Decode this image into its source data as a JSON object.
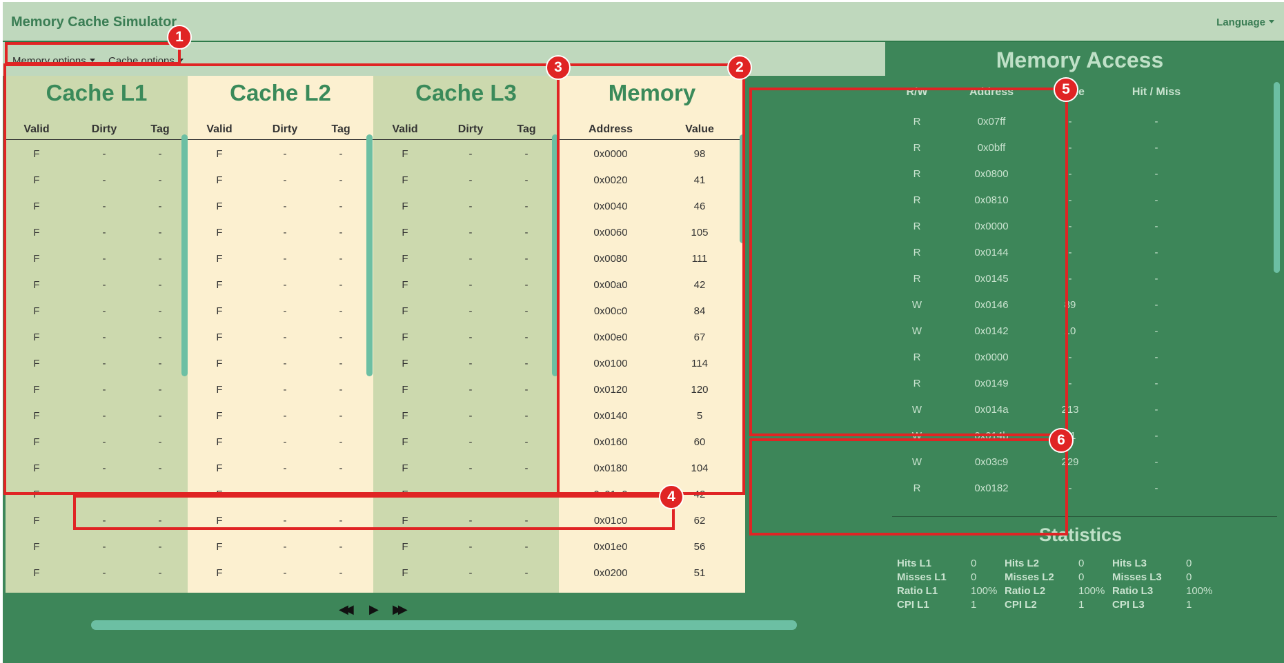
{
  "app": {
    "title": "Memory Cache Simulator",
    "language_label": "Language"
  },
  "options": {
    "memory": "Memory options",
    "cache": "Cache options"
  },
  "cache_headers": [
    "Valid",
    "Dirty",
    "Tag"
  ],
  "caches": [
    {
      "title": "Cache L1",
      "rows": [
        [
          "F",
          "-",
          "-"
        ],
        [
          "F",
          "-",
          "-"
        ],
        [
          "F",
          "-",
          "-"
        ],
        [
          "F",
          "-",
          "-"
        ],
        [
          "F",
          "-",
          "-"
        ],
        [
          "F",
          "-",
          "-"
        ],
        [
          "F",
          "-",
          "-"
        ],
        [
          "F",
          "-",
          "-"
        ],
        [
          "F",
          "-",
          "-"
        ],
        [
          "F",
          "-",
          "-"
        ],
        [
          "F",
          "-",
          "-"
        ],
        [
          "F",
          "-",
          "-"
        ],
        [
          "F",
          "-",
          "-"
        ],
        [
          "F",
          "-",
          "-"
        ],
        [
          "F",
          "-",
          "-"
        ],
        [
          "F",
          "-",
          "-"
        ],
        [
          "F",
          "-",
          "-"
        ]
      ]
    },
    {
      "title": "Cache L2",
      "rows": [
        [
          "F",
          "-",
          "-"
        ],
        [
          "F",
          "-",
          "-"
        ],
        [
          "F",
          "-",
          "-"
        ],
        [
          "F",
          "-",
          "-"
        ],
        [
          "F",
          "-",
          "-"
        ],
        [
          "F",
          "-",
          "-"
        ],
        [
          "F",
          "-",
          "-"
        ],
        [
          "F",
          "-",
          "-"
        ],
        [
          "F",
          "-",
          "-"
        ],
        [
          "F",
          "-",
          "-"
        ],
        [
          "F",
          "-",
          "-"
        ],
        [
          "F",
          "-",
          "-"
        ],
        [
          "F",
          "-",
          "-"
        ],
        [
          "F",
          "-",
          "-"
        ],
        [
          "F",
          "-",
          "-"
        ],
        [
          "F",
          "-",
          "-"
        ],
        [
          "F",
          "-",
          "-"
        ]
      ]
    },
    {
      "title": "Cache L3",
      "rows": [
        [
          "F",
          "-",
          "-"
        ],
        [
          "F",
          "-",
          "-"
        ],
        [
          "F",
          "-",
          "-"
        ],
        [
          "F",
          "-",
          "-"
        ],
        [
          "F",
          "-",
          "-"
        ],
        [
          "F",
          "-",
          "-"
        ],
        [
          "F",
          "-",
          "-"
        ],
        [
          "F",
          "-",
          "-"
        ],
        [
          "F",
          "-",
          "-"
        ],
        [
          "F",
          "-",
          "-"
        ],
        [
          "F",
          "-",
          "-"
        ],
        [
          "F",
          "-",
          "-"
        ],
        [
          "F",
          "-",
          "-"
        ],
        [
          "F",
          "-",
          "-"
        ],
        [
          "F",
          "-",
          "-"
        ],
        [
          "F",
          "-",
          "-"
        ],
        [
          "F",
          "-",
          "-"
        ]
      ]
    }
  ],
  "memory": {
    "title": "Memory",
    "headers": [
      "Address",
      "Value"
    ],
    "rows": [
      [
        "0x0000",
        "98"
      ],
      [
        "0x0020",
        "41"
      ],
      [
        "0x0040",
        "46"
      ],
      [
        "0x0060",
        "105"
      ],
      [
        "0x0080",
        "111"
      ],
      [
        "0x00a0",
        "42"
      ],
      [
        "0x00c0",
        "84"
      ],
      [
        "0x00e0",
        "67"
      ],
      [
        "0x0100",
        "114"
      ],
      [
        "0x0120",
        "120"
      ],
      [
        "0x0140",
        "5"
      ],
      [
        "0x0160",
        "60"
      ],
      [
        "0x0180",
        "104"
      ],
      [
        "0x01a0",
        "42"
      ],
      [
        "0x01c0",
        "62"
      ],
      [
        "0x01e0",
        "56"
      ],
      [
        "0x0200",
        "51"
      ]
    ]
  },
  "controls": {
    "rewind": "◀◀",
    "play": "▶",
    "forward": "▶▶"
  },
  "access": {
    "title": "Memory Access",
    "headers": [
      "R/W",
      "Address",
      "Value",
      "Hit / Miss"
    ],
    "rows": [
      [
        "R",
        "0x07ff",
        "-",
        "-"
      ],
      [
        "R",
        "0x0bff",
        "-",
        "-"
      ],
      [
        "R",
        "0x0800",
        "-",
        "-"
      ],
      [
        "R",
        "0x0810",
        "-",
        "-"
      ],
      [
        "R",
        "0x0000",
        "-",
        "-"
      ],
      [
        "R",
        "0x0144",
        "-",
        "-"
      ],
      [
        "R",
        "0x0145",
        "-",
        "-"
      ],
      [
        "W",
        "0x0146",
        "89",
        "-"
      ],
      [
        "W",
        "0x0142",
        "10",
        "-"
      ],
      [
        "R",
        "0x0000",
        "-",
        "-"
      ],
      [
        "R",
        "0x0149",
        "-",
        "-"
      ],
      [
        "W",
        "0x014a",
        "213",
        "-"
      ],
      [
        "W",
        "0x014b",
        "61",
        "-"
      ],
      [
        "W",
        "0x03c9",
        "229",
        "-"
      ],
      [
        "R",
        "0x0182",
        "-",
        "-"
      ]
    ]
  },
  "statistics": {
    "title": "Statistics",
    "groups": [
      {
        "items": [
          {
            "label": "Hits L1",
            "value": "0"
          },
          {
            "label": "Misses L1",
            "value": "0"
          },
          {
            "label": "Ratio L1",
            "value": "100%"
          },
          {
            "label": "CPI L1",
            "value": "1"
          }
        ]
      },
      {
        "items": [
          {
            "label": "Hits L2",
            "value": "0"
          },
          {
            "label": "Misses L2",
            "value": "0"
          },
          {
            "label": "Ratio L2",
            "value": "100%"
          },
          {
            "label": "CPI L2",
            "value": "1"
          }
        ]
      },
      {
        "items": [
          {
            "label": "Hits L3",
            "value": "0"
          },
          {
            "label": "Misses L3",
            "value": "0"
          },
          {
            "label": "Ratio L3",
            "value": "100%"
          },
          {
            "label": "CPI L3",
            "value": "1"
          }
        ]
      }
    ]
  },
  "annotations": [
    "1",
    "2",
    "3",
    "4",
    "5",
    "6"
  ],
  "colors": {
    "highlight": "#e02424",
    "panel": "#3d8659",
    "navbar": "#bfd8bd",
    "cache_green": "#ccd9ae",
    "cream": "#fcf0d0",
    "accent": "#3a8a5a",
    "scroll": "#6cbfa3"
  }
}
